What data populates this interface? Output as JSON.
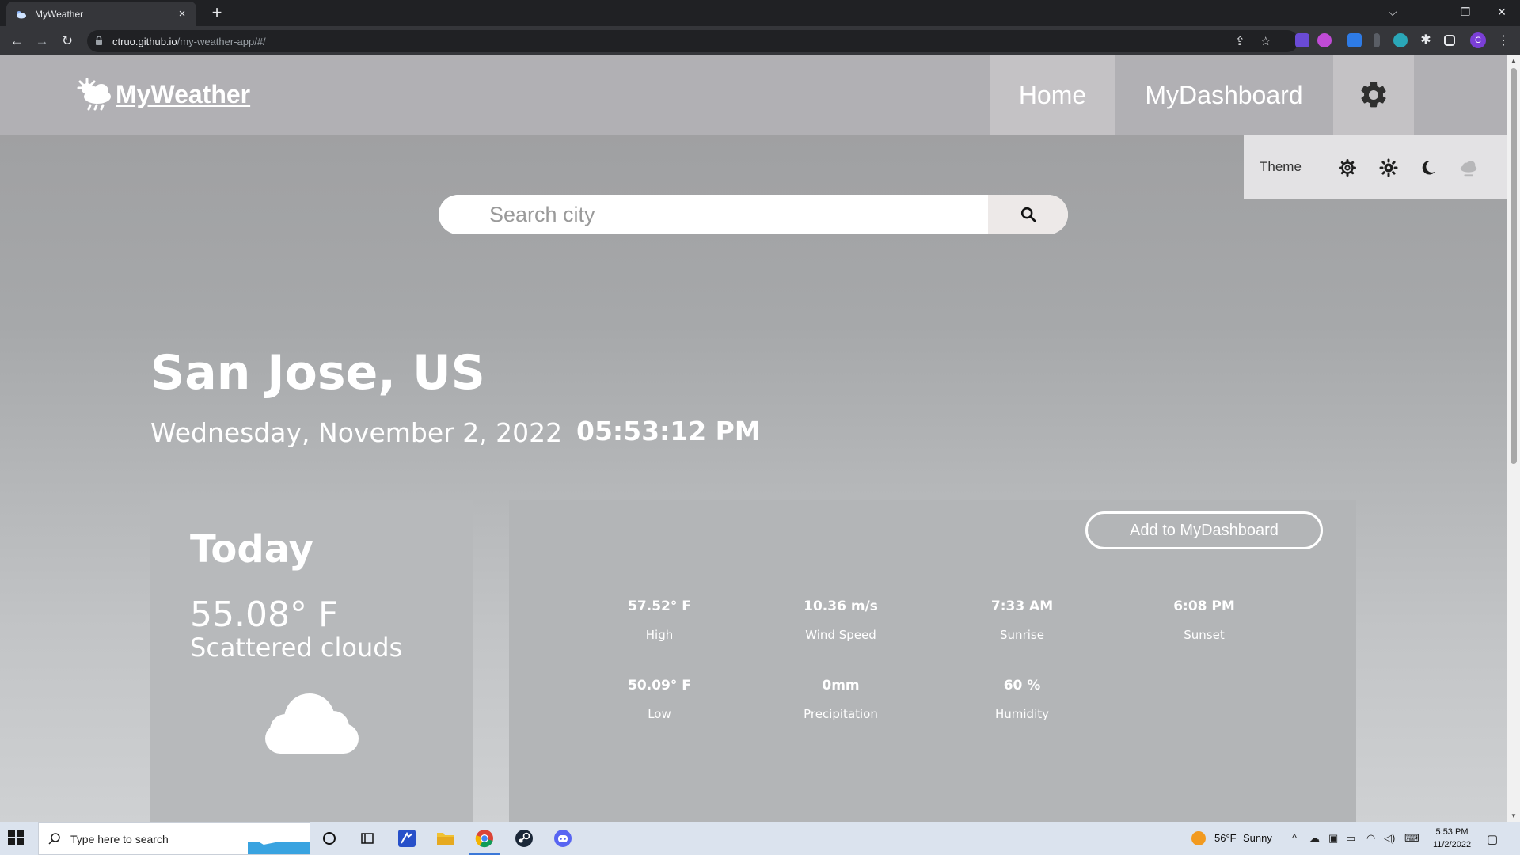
{
  "browser": {
    "tab_title": "MyWeather",
    "tab_close": "×",
    "new_tab": "+",
    "url_host": "ctruo.github.io",
    "url_path": "/my-weather-app/#/",
    "profile_initial": "C",
    "window_controls": {
      "dropdown": "⌵",
      "minimize": "—",
      "restore": "❐",
      "close": "✕"
    }
  },
  "navbar": {
    "brand": "MyWeather",
    "home": "Home",
    "dashboard": "MyDashboard"
  },
  "theme_menu": {
    "label": "Theme",
    "options": [
      "system-gear-icon",
      "sun-icon",
      "moon-icon",
      "cloud-icon"
    ]
  },
  "search": {
    "placeholder": "Search city"
  },
  "location": {
    "city": "San Jose, US",
    "date": "Wednesday, November 2, 2022",
    "time": "05:53:12 PM"
  },
  "today": {
    "title": "Today",
    "temp": "55.08° F",
    "description": "Scattered clouds",
    "icon": "cloud-icon"
  },
  "details": {
    "add_button": "Add to MyDashboard",
    "stats": [
      {
        "value": "57.52° F",
        "label": "High"
      },
      {
        "value": "10.36 m/s",
        "label": "Wind Speed"
      },
      {
        "value": "7:33 AM",
        "label": "Sunrise"
      },
      {
        "value": "6:08 PM",
        "label": "Sunset"
      },
      {
        "value": "50.09° F",
        "label": "Low"
      },
      {
        "value": "0mm",
        "label": "Precipitation"
      },
      {
        "value": "60 %",
        "label": "Humidity"
      }
    ]
  },
  "taskbar": {
    "search_placeholder": "Type here to search",
    "weather_temp": "56°F",
    "weather_desc": "Sunny",
    "clock_time": "5:53 PM",
    "clock_date": "11/2/2022"
  },
  "colors": {
    "navbar_bg": "#b1b0b4",
    "nav_active_bg": "#c4c2c5",
    "theme_menu_bg": "#e3e2e4",
    "card_bg": "#b7b9bb",
    "text": "#ffffff"
  }
}
